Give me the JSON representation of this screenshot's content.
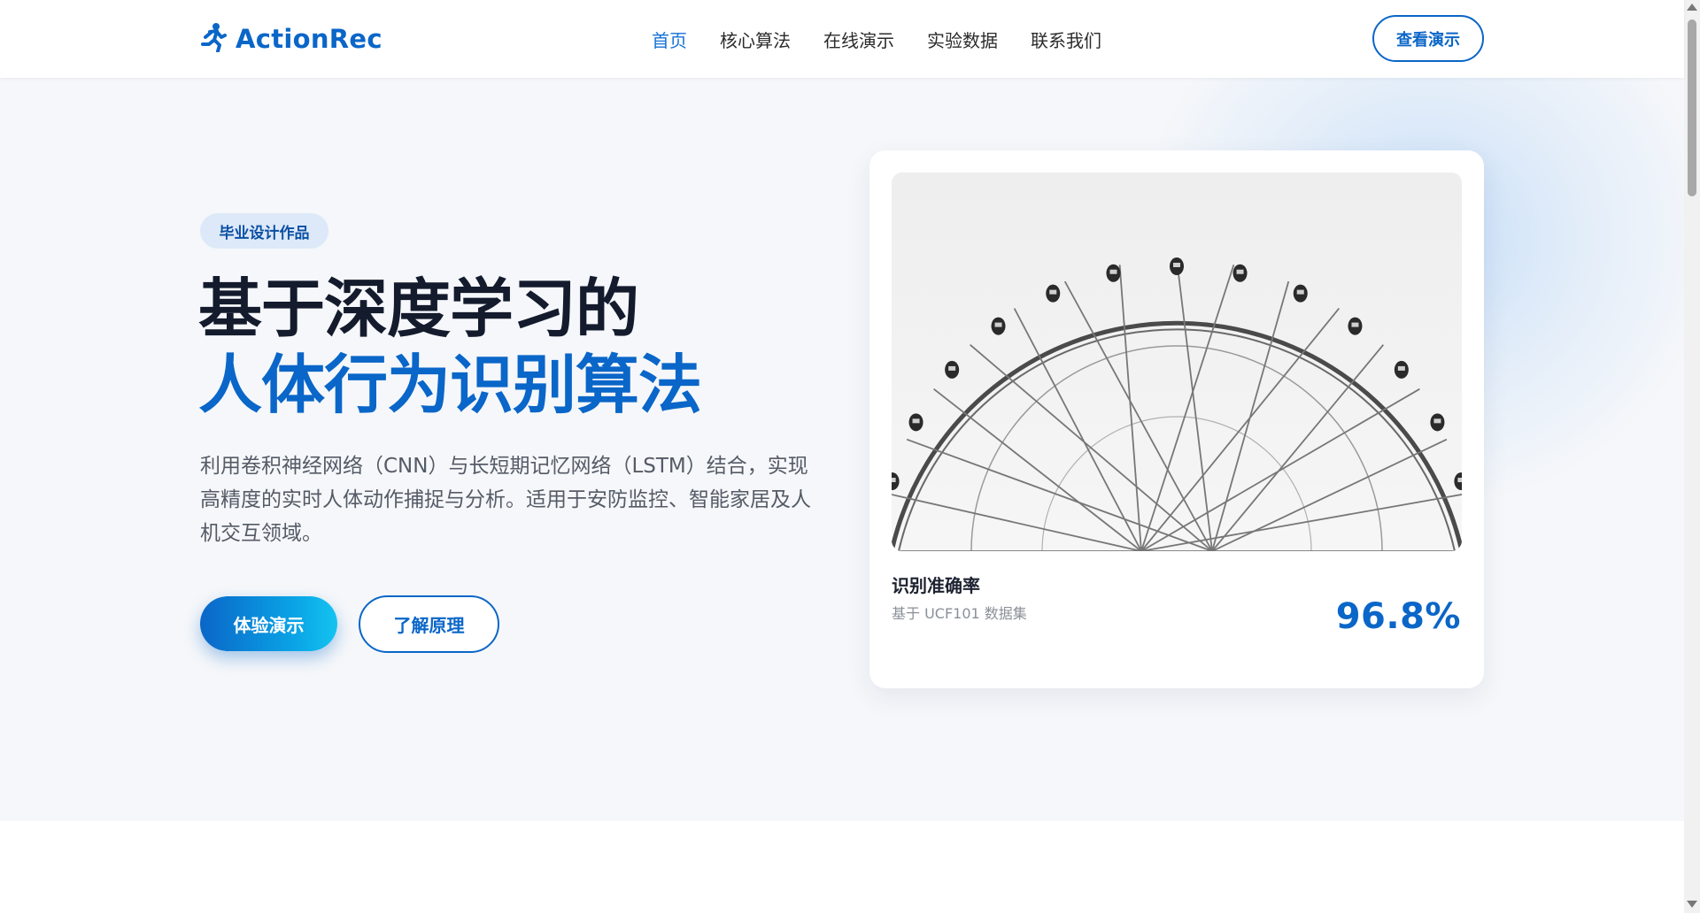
{
  "brand": {
    "name": "ActionRec",
    "icon": "running-person-icon"
  },
  "nav": {
    "items": [
      {
        "label": "首页",
        "active": true
      },
      {
        "label": "核心算法",
        "active": false
      },
      {
        "label": "在线演示",
        "active": false
      },
      {
        "label": "实验数据",
        "active": false
      },
      {
        "label": "联系我们",
        "active": false
      }
    ],
    "cta_label": "查看演示"
  },
  "hero": {
    "badge": "毕业设计作品",
    "title_line1": "基于深度学习的",
    "title_line2": "人体行为识别算法",
    "description": "利用卷积神经网络（CNN）与长短期记忆网络（LSTM）结合，实现高精度的实时人体动作捕捉与分析。适用于安防监控、智能家居及人机交互领域。",
    "primary_button": "体验演示",
    "secondary_button": "了解原理"
  },
  "card": {
    "image_subject": "ferris-wheel-photo",
    "title": "识别准确率",
    "subtitle": "基于 UCF101 数据集",
    "value": "96.8%"
  },
  "colors": {
    "accent": "#0a66c8",
    "title_dark": "#141b2d",
    "hero_bg": "#f5f7fa",
    "badge_bg": "#dde9f8"
  }
}
